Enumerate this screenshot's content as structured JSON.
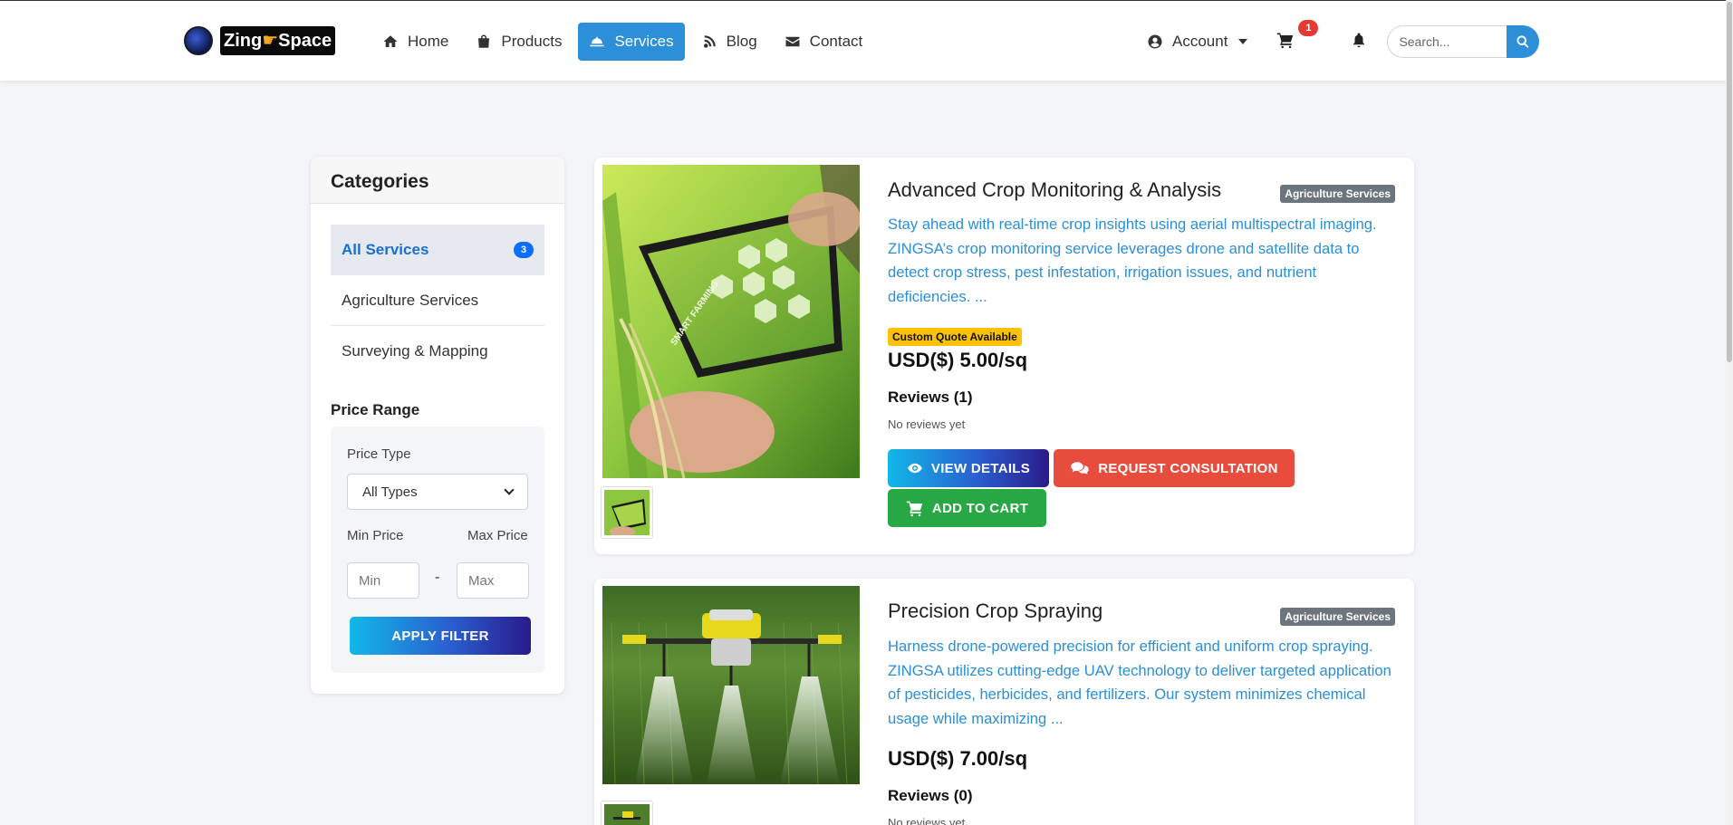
{
  "brand": {
    "name_part1": "Zing",
    "name_part2": "Space",
    "hand_icon": "pointing-hand-icon"
  },
  "nav": {
    "items": [
      {
        "label": "Home",
        "icon": "home-icon"
      },
      {
        "label": "Products",
        "icon": "shopping-bag-icon"
      },
      {
        "label": "Services",
        "icon": "service-bell-icon",
        "active": true
      },
      {
        "label": "Blog",
        "icon": "blog-icon"
      },
      {
        "label": "Contact",
        "icon": "envelope-icon"
      }
    ],
    "account_label": "Account",
    "cart_count": "1",
    "search_placeholder": "Search..."
  },
  "sidebar": {
    "title": "Categories",
    "categories": [
      {
        "label": "All Services",
        "count": "3",
        "active": true
      },
      {
        "label": "Agriculture Services"
      },
      {
        "label": "Surveying & Mapping"
      }
    ],
    "price_range_title": "Price Range",
    "price_type_label": "Price Type",
    "price_type_value": "All Types",
    "min_label": "Min Price",
    "max_label": "Max Price",
    "min_placeholder": "Min",
    "max_placeholder": "Max",
    "dash": "-",
    "apply_label": "APPLY FILTER"
  },
  "products": [
    {
      "title": "Advanced Crop Monitoring & Analysis",
      "category": "Agriculture Services",
      "description": "Stay ahead with real-time crop insights using aerial multispectral imaging. ZINGSA’s crop monitoring service leverages drone and satellite data to detect crop stress, pest infestation, irrigation issues, and nutrient deficiencies. ...",
      "quote_badge": "Custom Quote Available",
      "price": "USD($) 5.00/sq",
      "reviews_title": "Reviews (1)",
      "reviews_text": "No reviews yet",
      "view_label": "VIEW DETAILS",
      "consult_label": "REQUEST CONSULTATION",
      "cart_label": "ADD TO CART",
      "tablet_text": "SMART FARMING"
    },
    {
      "title": "Precision Crop Spraying",
      "category": "Agriculture Services",
      "description": "Harness drone-powered precision for efficient and uniform crop spraying. ZINGSA utilizes cutting-edge UAV technology to deliver targeted application of pesticides, herbicides, and fertilizers. Our system minimizes chemical usage while maximizing ...",
      "price": "USD($) 7.00/sq",
      "reviews_title": "Reviews (0)",
      "reviews_text": "No reviews yet"
    }
  ],
  "colors": {
    "primary": "#2c8fd8",
    "danger": "#e84c3d",
    "success": "#27a844",
    "warning": "#ffc107",
    "badge_gray": "#6c757d"
  }
}
